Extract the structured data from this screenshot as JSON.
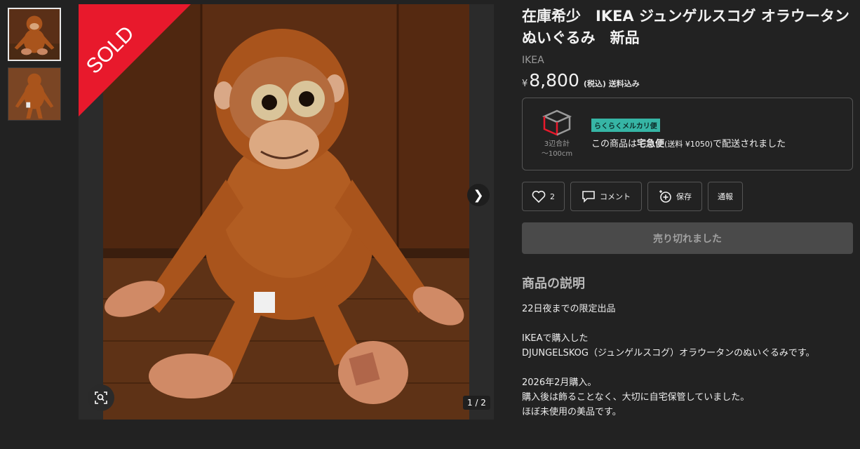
{
  "gallery": {
    "sold_label": "SOLD",
    "counter": "1 / 2",
    "thumbnails": [
      "thumb-1",
      "thumb-2"
    ],
    "icons": {
      "next": "chevron-right-icon",
      "zoom": "zoom-scan-icon"
    }
  },
  "product": {
    "title": "在庫希少　IKEA ジュンゲルスコグ オラウータン ぬいぐるみ　新品",
    "brand": "IKEA",
    "currency": "¥",
    "price": "8,800",
    "price_note": "(税込) 送料込み"
  },
  "shipping": {
    "size_line1": "3辺合計",
    "size_line2": "〜100cm",
    "badge": "らくらくメルカリ便",
    "msg_prefix": "この商品は",
    "msg_method": "宅急便",
    "msg_fee": "(送料 ¥1050)",
    "msg_suffix": "で配送されました"
  },
  "actions": {
    "like_count": "2",
    "comment": "コメント",
    "save": "保存",
    "report": "通報",
    "sold_out": "売り切れました"
  },
  "description": {
    "heading": "商品の説明",
    "body": "22日夜までの限定出品\n\nIKEAで購入した\nDJUNGELSKOG（ジュンゲルスコグ）オラウータンのぬいぐるみです。\n\n2026年2月購入。\n購入後は飾ることなく、大切に自宅保管していました。\nほぼ未使用の美品です。"
  },
  "colors": {
    "background": "#222222",
    "sold_red": "#e8192c",
    "badge_teal": "#36b5a5",
    "orangutan": "#a9541c"
  }
}
